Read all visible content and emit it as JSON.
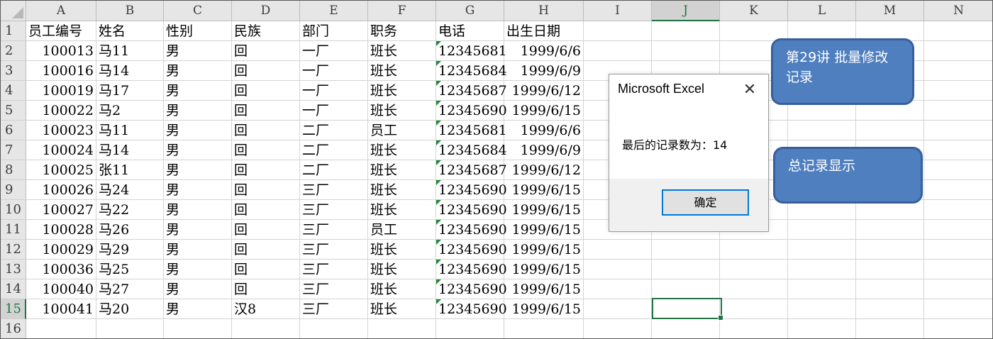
{
  "columns": [
    "A",
    "B",
    "C",
    "D",
    "E",
    "F",
    "G",
    "H",
    "I",
    "J",
    "K",
    "L",
    "M",
    "N"
  ],
  "selected_column": "J",
  "row_numbers": [
    "1",
    "2",
    "3",
    "4",
    "5",
    "6",
    "7",
    "8",
    "9",
    "10",
    "11",
    "12",
    "13",
    "14",
    "15",
    "16"
  ],
  "selected_row": "15",
  "headers": [
    "员工编号",
    "姓名",
    "性别",
    "民族",
    "部门",
    "职务",
    "电话",
    "出生日期"
  ],
  "rows": [
    [
      "100013",
      "马11",
      "男",
      "回",
      "一厂",
      "班长",
      "12345681",
      "1999/6/6"
    ],
    [
      "100016",
      "马14",
      "男",
      "回",
      "一厂",
      "班长",
      "12345684",
      "1999/6/9"
    ],
    [
      "100019",
      "马17",
      "男",
      "回",
      "一厂",
      "班长",
      "12345687",
      "1999/6/12"
    ],
    [
      "100022",
      "马2",
      "男",
      "回",
      "一厂",
      "班长",
      "12345690",
      "1999/6/15"
    ],
    [
      "100023",
      "马11",
      "男",
      "回",
      "二厂",
      "员工",
      "12345681",
      "1999/6/6"
    ],
    [
      "100024",
      "马14",
      "男",
      "回",
      "二厂",
      "班长",
      "12345684",
      "1999/6/9"
    ],
    [
      "100025",
      "张11",
      "男",
      "回",
      "二厂",
      "班长",
      "12345687",
      "1999/6/12"
    ],
    [
      "100026",
      "马24",
      "男",
      "回",
      "三厂",
      "班长",
      "12345690",
      "1999/6/15"
    ],
    [
      "100027",
      "马22",
      "男",
      "回",
      "三厂",
      "班长",
      "12345690",
      "1999/6/15"
    ],
    [
      "100028",
      "马26",
      "男",
      "回",
      "三厂",
      "员工",
      "12345690",
      "1999/6/15"
    ],
    [
      "100029",
      "马29",
      "男",
      "回",
      "三厂",
      "班长",
      "12345690",
      "1999/6/15"
    ],
    [
      "100036",
      "马25",
      "男",
      "回",
      "三厂",
      "班长",
      "12345690",
      "1999/6/15"
    ],
    [
      "100040",
      "马27",
      "男",
      "回",
      "三厂",
      "班长",
      "12345690",
      "1999/6/15"
    ],
    [
      "100041",
      "马20",
      "男",
      "汉8",
      "三厂",
      "班长",
      "12345690",
      "1999/6/15"
    ]
  ],
  "dialog": {
    "title": "Microsoft Excel",
    "close_glyph": "✕",
    "message": "最后的记录数为：14",
    "ok_label": "确定"
  },
  "callouts": {
    "lesson": "第29讲 批量修改记录",
    "total": "总记录显示"
  },
  "colors": {
    "header_bg": "#e6e6e6",
    "selection_green": "#217346",
    "callout_fill": "#4f7fbf",
    "callout_border": "#37609b"
  }
}
